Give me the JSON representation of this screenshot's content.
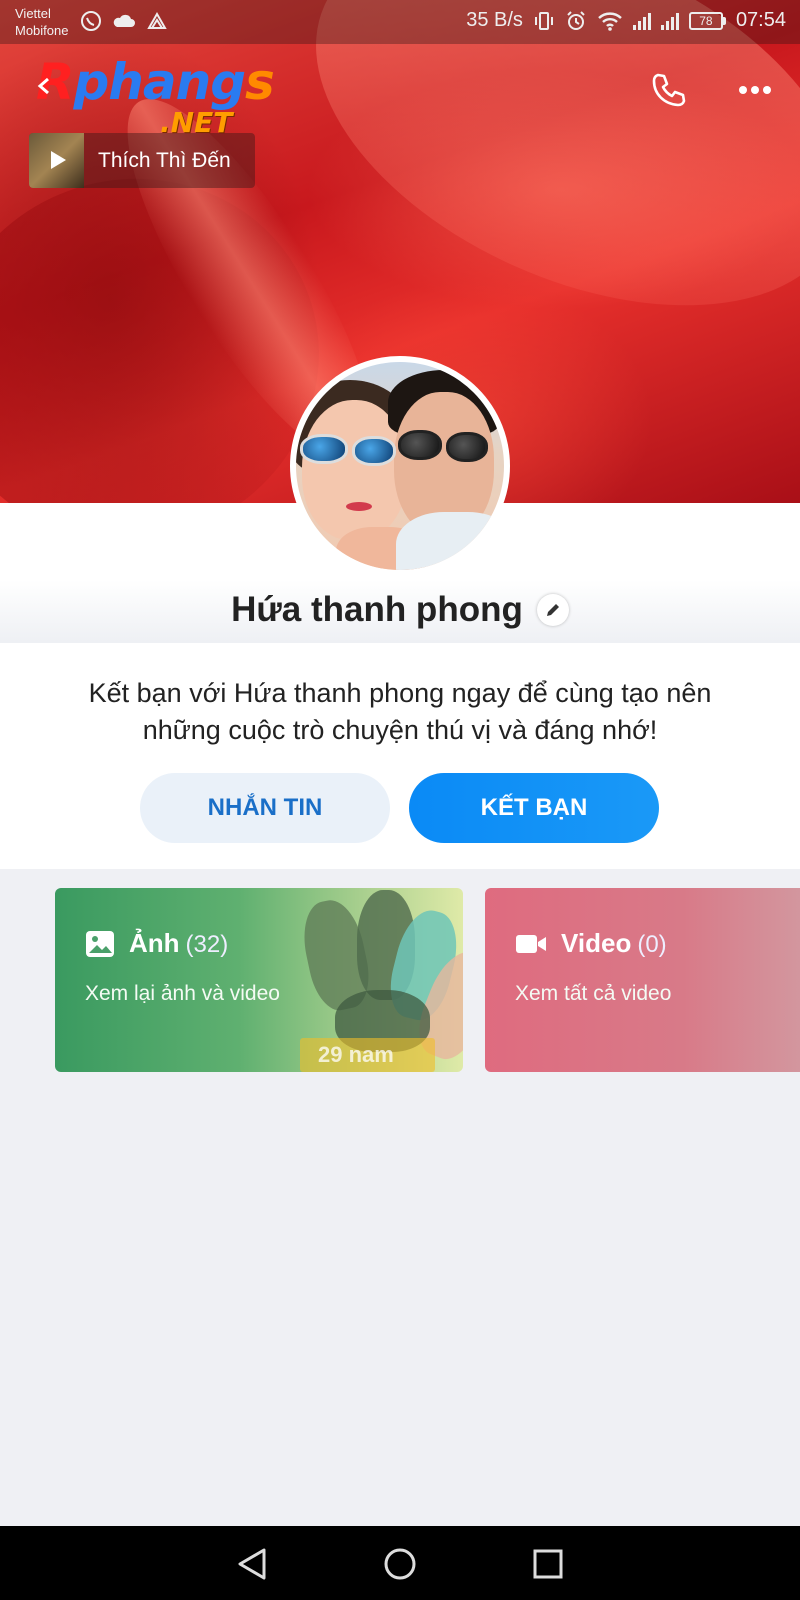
{
  "status_bar": {
    "carrier_1": "Viettel",
    "carrier_2": "Mobifone",
    "net_speed": "35 B/s",
    "battery": "78",
    "time": "07:54"
  },
  "watermark": {
    "brand_letters": [
      "R",
      "phang",
      "s"
    ],
    "domain": ".NET"
  },
  "music": {
    "title": "Thích Thì Đến"
  },
  "profile": {
    "name": "Hứa thanh phong"
  },
  "invite": {
    "message": "Kết bạn với Hứa thanh phong ngay để cùng tạo nên những cuộc trò chuyện thú vị và đáng nhớ!",
    "message_button": "NHẮN TIN",
    "add_friend_button": "KẾT BẠN"
  },
  "media": {
    "photos": {
      "title": "Ảnh",
      "count": "(32)",
      "subtitle": "Xem lại ảnh và video",
      "tag": "29 nam"
    },
    "videos": {
      "title": "Video",
      "count": "(0)",
      "subtitle": "Xem tất cả video"
    }
  },
  "icons": [
    "back-arrow-icon",
    "phone-icon",
    "more-icon",
    "play-icon",
    "edit-icon",
    "image-icon",
    "video-camera-icon",
    "nav-back-icon",
    "nav-home-icon",
    "nav-recents-icon"
  ],
  "colors": {
    "accent": "#0a8af6",
    "photos_card": "#3a9a60",
    "video_card": "#df6b7f"
  }
}
